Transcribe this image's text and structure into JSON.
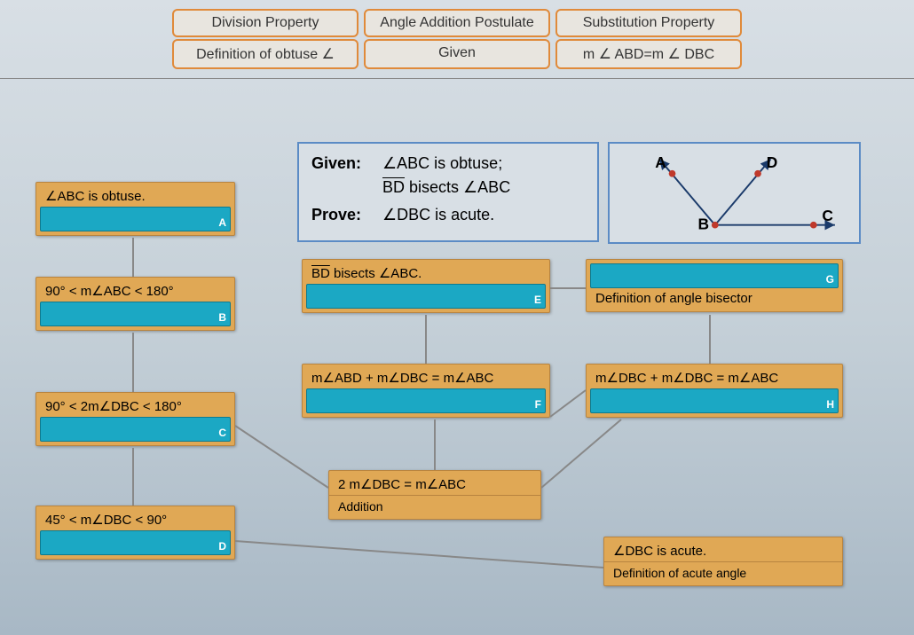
{
  "options": {
    "row1": [
      "Division Property",
      "Angle Addition Postulate",
      "Substitution Property"
    ],
    "row2": [
      "Definition of obtuse ∠",
      "Given",
      "m ∠ ABD=m ∠ DBC"
    ]
  },
  "given_prove": {
    "given_label": "Given:",
    "given_line1": "∠ABC is obtuse;",
    "given_line2": "BD bisects ∠ABC",
    "prove_label": "Prove:",
    "prove_text": "∠DBC is acute."
  },
  "diagram": {
    "labels": {
      "A": "A",
      "B": "B",
      "C": "C",
      "D": "D"
    }
  },
  "boxes": {
    "A": {
      "statement": "∠ABC is obtuse.",
      "letter": "A"
    },
    "B": {
      "statement": "90° < m∠ABC < 180°",
      "letter": "B"
    },
    "C": {
      "statement": "90° < 2m∠DBC < 180°",
      "letter": "C"
    },
    "D": {
      "statement": "45° < m∠DBC < 90°",
      "letter": "D"
    },
    "E": {
      "statement": "BD bisects ∠ABC.",
      "letter": "E"
    },
    "F": {
      "statement": "m∠ABD + m∠DBC = m∠ABC",
      "letter": "F"
    },
    "G": {
      "statement": "Definition of angle bisector",
      "letter": "G"
    },
    "H": {
      "statement": "m∠DBC + m∠DBC = m∠ABC",
      "letter": "H"
    },
    "addition": {
      "statement": "2 m∠DBC = m∠ABC",
      "reason": "Addition"
    },
    "acute": {
      "statement": "∠DBC is acute.",
      "reason": "Definition of acute angle"
    }
  }
}
